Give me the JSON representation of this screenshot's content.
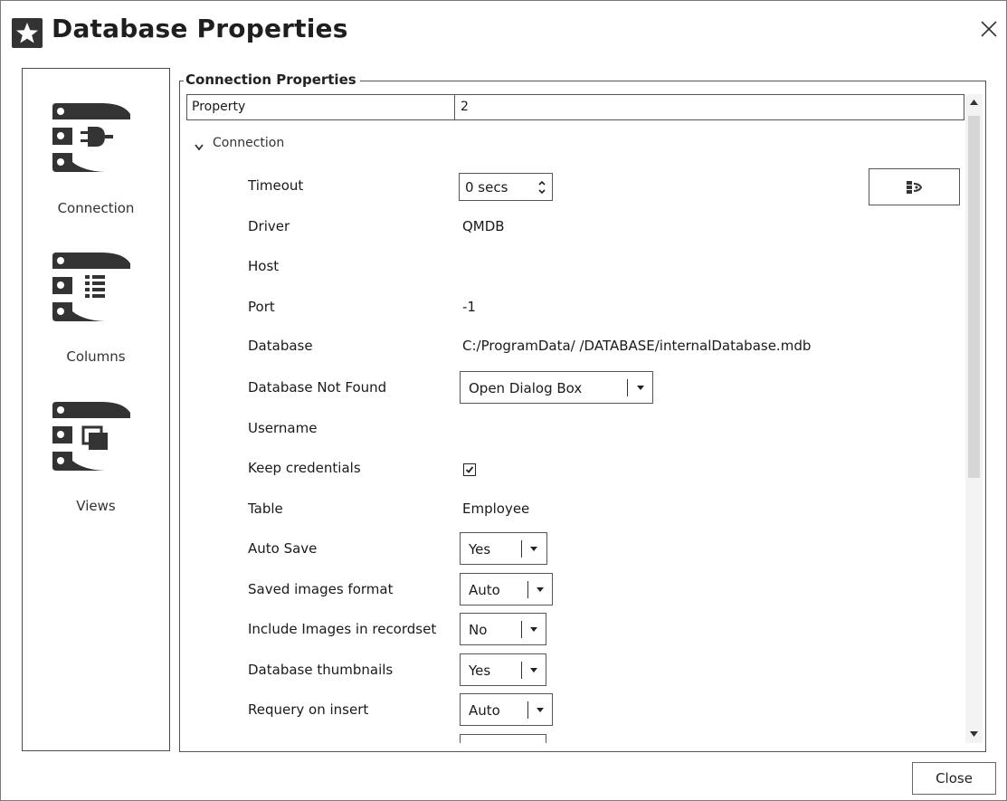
{
  "window": {
    "title": "Database Properties",
    "app_icon": "star-icon",
    "close_icon": "close-icon"
  },
  "sidebar": {
    "items": [
      {
        "label": "Connection",
        "icon": "database-plug-icon"
      },
      {
        "label": "Columns",
        "icon": "database-columns-icon"
      },
      {
        "label": "Views",
        "icon": "database-views-icon"
      }
    ]
  },
  "group": {
    "title": "Connection Properties"
  },
  "table_header": {
    "col1": "Property",
    "col2": "2"
  },
  "section": {
    "label": "Connection",
    "expanded": true
  },
  "properties": {
    "timeout": {
      "label": "Timeout",
      "value": "0 secs"
    },
    "driver": {
      "label": "Driver",
      "value": "QMDB"
    },
    "host": {
      "label": "Host",
      "value": ""
    },
    "port": {
      "label": "Port",
      "value": "-1"
    },
    "database": {
      "label": "Database",
      "value": "C:/ProgramData/            /DATABASE/internalDatabase.mdb"
    },
    "db_not_found": {
      "label": "Database Not Found",
      "value": "Open Dialog Box"
    },
    "username": {
      "label": "Username",
      "value": ""
    },
    "keep_credentials": {
      "label": "Keep credentials",
      "checked": true
    },
    "table": {
      "label": "Table",
      "value": "Employee"
    },
    "auto_save": {
      "label": "Auto Save",
      "value": "Yes"
    },
    "saved_images_format": {
      "label": "Saved images format",
      "value": "Auto"
    },
    "include_images": {
      "label": "Include Images in recordset",
      "value": "No"
    },
    "thumbnails": {
      "label": "Database thumbnails",
      "value": "Yes"
    },
    "requery": {
      "label": "Requery on insert",
      "value": "Auto"
    }
  },
  "side_button_icon": "database-connect-icon",
  "footer": {
    "close_label": "Close"
  },
  "colors": {
    "border": "#555555",
    "icon_dark": "#333333",
    "scrollbar_thumb": "#d6d6d6"
  }
}
